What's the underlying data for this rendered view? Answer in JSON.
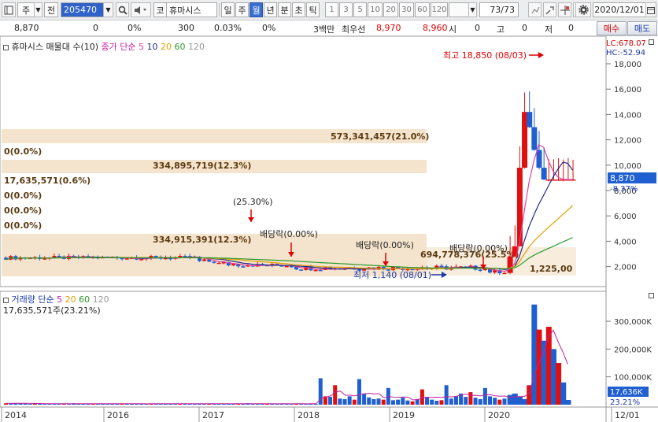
{
  "toolbar": {
    "market": "주",
    "prev": "전",
    "code": "205470",
    "code_prefix": "코",
    "stock_name": "휴마시스",
    "periods": [
      "일",
      "주",
      "월",
      "년",
      "분",
      "초",
      "틱"
    ],
    "selected_period": "월",
    "nums": [
      "1",
      "3",
      "5",
      "10",
      "20",
      "30",
      "60",
      "120"
    ],
    "count": "73",
    "count_total": "/73",
    "date": "2020/12/01"
  },
  "info": {
    "price": "8,870",
    "change": "0",
    "change_pct": "0%",
    "volume": "300",
    "volume_pct": "0.03%",
    "rate": "0%",
    "unit": "3백만",
    "best_label": "최우선",
    "ask": "8,970",
    "bid": "8,960",
    "open_label": "시",
    "open": "0",
    "high_label": "고",
    "high": "0",
    "low_label": "저",
    "low": "0",
    "buy_label": "매수",
    "sell_label": "매도"
  },
  "price_panel": {
    "title": "휴마시스 매물대 수(10)",
    "ma_label": "종가 단순",
    "ma_periods": [
      "5",
      "10",
      "20",
      "60",
      "120"
    ],
    "ma_colors": [
      "#e040a0",
      "#1e2a8a",
      "#e0a000",
      "#2a9a2a",
      "#999999"
    ],
    "lc": "LC:678.07",
    "hc": "HC:-52.94",
    "current_price": "8,870",
    "current_change": "-8.37%",
    "high_note": "최고 18,850 (08/03)",
    "low_note": "최저 1,140 (08/01)",
    "annotations": [
      "(25.30%)",
      "배당락(0.00%)",
      "배당락(0.00%)",
      "배당락(0.00%)"
    ],
    "volume_profile": [
      "573,341,457(21.0%)",
      "0(0.0%)",
      "334,895,719(12.3%)",
      "17,635,571(0.6%)",
      "0(0.0%)",
      "0(0.0%)",
      "0(0.0%)",
      "334,915,391(12.3%)",
      "694,778,376(25.5%)",
      "1,225,00"
    ],
    "y_ticks": [
      "18,000",
      "16,000",
      "14,000",
      "12,000",
      "10,000",
      "8,000",
      "6,000",
      "4,000",
      "2,000"
    ]
  },
  "volume_panel": {
    "title": "거래량 단순",
    "ma_periods": [
      "5",
      "20",
      "60",
      "120"
    ],
    "value": "17,635,571주(23.21%)",
    "current": "17,636K",
    "current_pct": "23.21%",
    "y_ticks": [
      "300,000K",
      "200,000K",
      "100,000K"
    ]
  },
  "x_axis": [
    "2014",
    "2016",
    "2017",
    "2018",
    "2019",
    "2020",
    "12/01"
  ],
  "chart_data": {
    "type": "candlestick",
    "monthly_volume_k": [
      5,
      4,
      6,
      5,
      4,
      3,
      5,
      4,
      3,
      4,
      3,
      3,
      4,
      3,
      5,
      4,
      3,
      4,
      3,
      4,
      3,
      3,
      4,
      3,
      4,
      3,
      3,
      4,
      3,
      3,
      4,
      3,
      4,
      3,
      3,
      4,
      3,
      4,
      3,
      3,
      4,
      3,
      4,
      3,
      3,
      4,
      3,
      4,
      3,
      3,
      5,
      4,
      3,
      3,
      4,
      3,
      3,
      4,
      3,
      3,
      4,
      3,
      3,
      4,
      3,
      95,
      30,
      28,
      70,
      22,
      20,
      30,
      18,
      92,
      38,
      26,
      20,
      22,
      18,
      60,
      16,
      18,
      25,
      15,
      12,
      20,
      55,
      28,
      18,
      14,
      16,
      70,
      22,
      30,
      40,
      28,
      45,
      25,
      20,
      60,
      30,
      25,
      18,
      22,
      35,
      40,
      30,
      20,
      70,
      360,
      270,
      230,
      280,
      200,
      150,
      80,
      17
    ]
  }
}
